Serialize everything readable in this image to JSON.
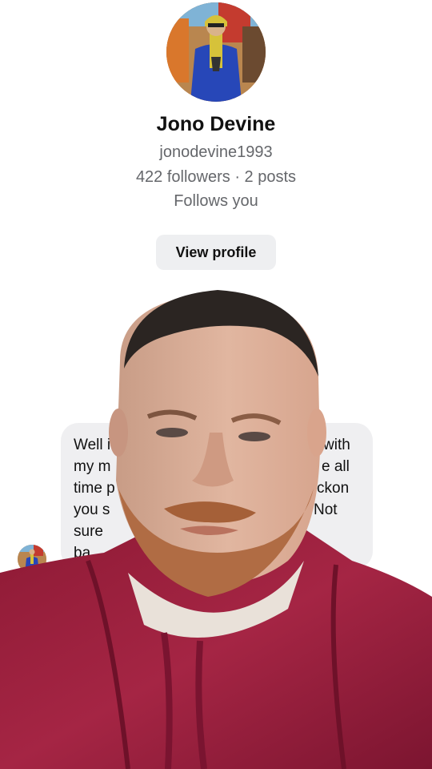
{
  "profile": {
    "name": "Jono Devine",
    "handle": "jonodevine1993",
    "stats": "422 followers · 2 posts",
    "follows_status": "Follows you",
    "view_profile_label": "View profile"
  },
  "message": {
    "visible_fragments": {
      "line1_left": "Well i",
      "line1_right": "with",
      "line2_left": "my m",
      "line2_right": "e all",
      "line3_left": "time p",
      "line3_right": "ckon",
      "line4_left": "you s",
      "line4_right": "Not",
      "line5_left": "sure",
      "line6_left": "ba"
    }
  }
}
